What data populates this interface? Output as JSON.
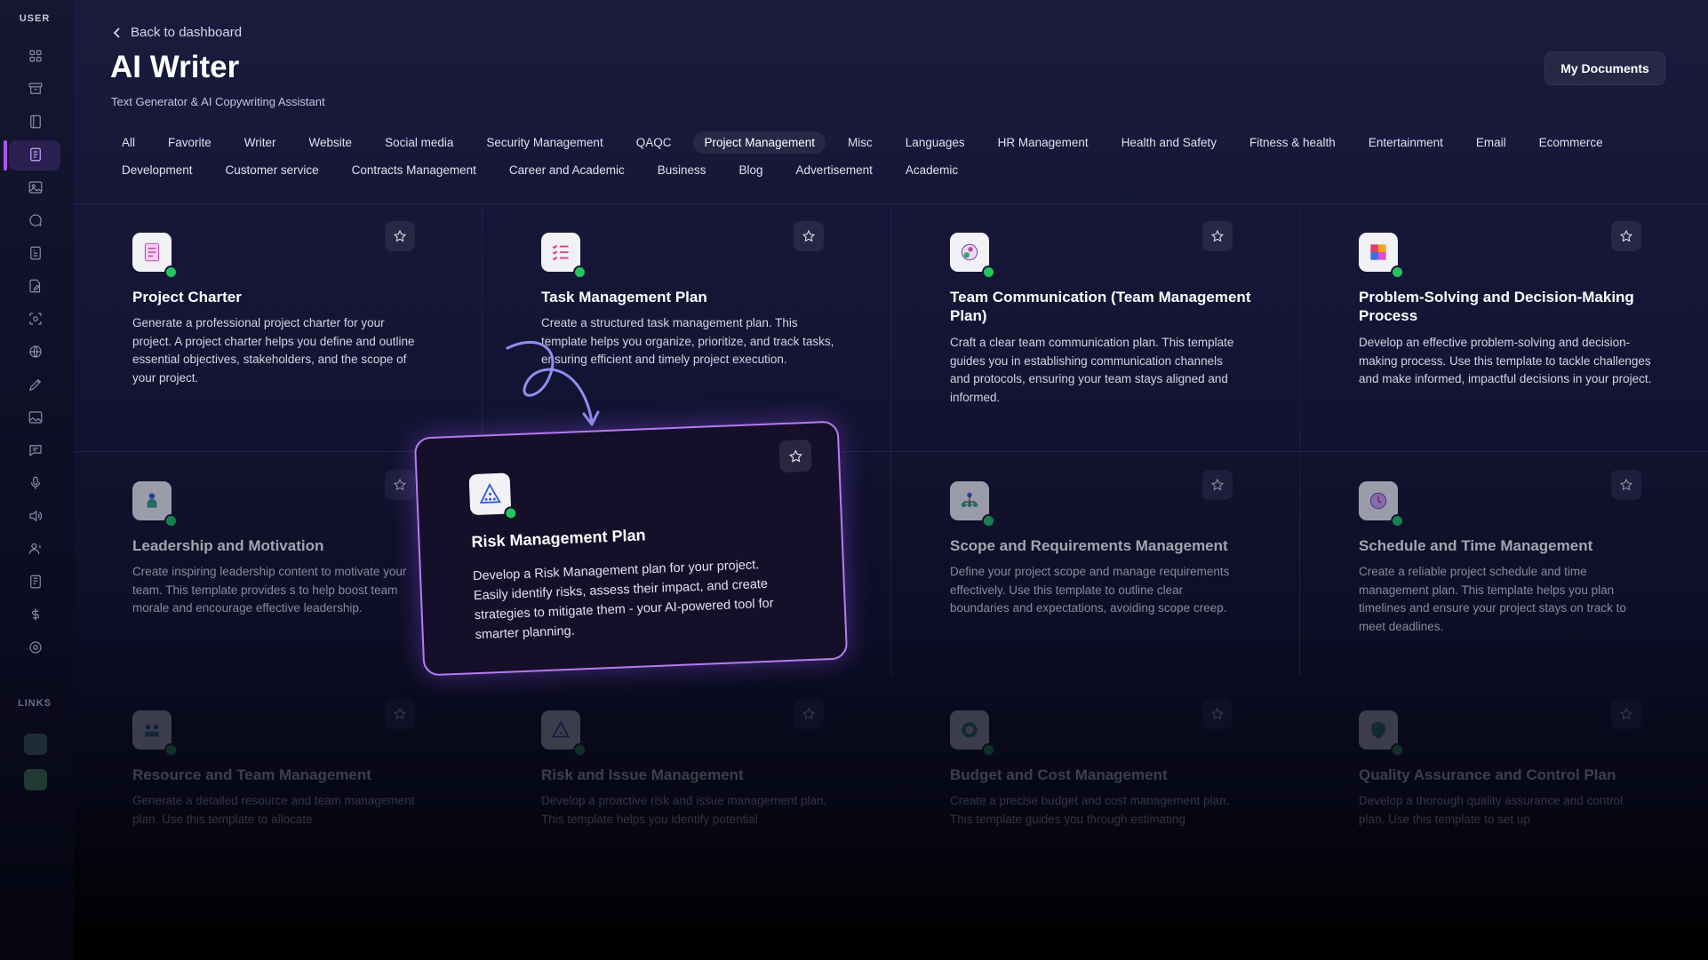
{
  "sidebar": {
    "user_label": "USER",
    "links_label": "LINKS",
    "icons": [
      "grid-icon",
      "archive-icon",
      "book-icon",
      "document-icon",
      "image-icon",
      "chat-bubble-icon",
      "file-text-icon",
      "file-edit-icon",
      "scan-icon",
      "globe-icon",
      "pen-icon",
      "photo-icon",
      "message-icon",
      "microphone-icon",
      "speaker-icon",
      "user-voice-icon",
      "notebook-icon",
      "dollar-icon",
      "settings-icon"
    ],
    "active_index": 3,
    "accent_color": "#a855f7"
  },
  "header": {
    "back_label": "Back to dashboard",
    "title": "AI Writer",
    "subtitle": "Text Generator & AI Copywriting Assistant",
    "my_documents_label": "My Documents"
  },
  "filters": {
    "row1": [
      "All",
      "Favorite",
      "Writer",
      "Website",
      "Social media",
      "Security Management",
      "QAQC",
      "Project Management",
      "Misc",
      "Languages",
      "HR Management",
      "Health and Safety",
      "Fitness & health",
      "Entertainment",
      "Email",
      "Ecommerce"
    ],
    "row2": [
      "Development",
      "Customer service",
      "Contracts Management",
      "Career and Academic",
      "Business",
      "Blog",
      "Advertisement",
      "Academic"
    ],
    "active": "Project Management"
  },
  "cards": [
    {
      "title": "Project Charter",
      "description": "Generate a professional project charter for your project. A project charter helps you define and outline essential objectives, stakeholders, and the scope of your project.",
      "icon": "charter-icon"
    },
    {
      "title": "Task Management Plan",
      "description": "Create a structured task management plan. This template helps you organize, prioritize, and track tasks, ensuring efficient and timely project execution.",
      "icon": "checklist-icon"
    },
    {
      "title": "Team Communication (Team Management Plan)",
      "description": "Craft a clear team communication plan. This template guides you in establishing communication channels and protocols, ensuring your team stays aligned and informed.",
      "icon": "team-chat-icon"
    },
    {
      "title": "Problem-Solving and Decision-Making Process",
      "description": "Develop an effective problem-solving and decision-making process. Use this template to tackle challenges and make informed, impactful decisions in your project.",
      "icon": "puzzle-icon"
    },
    {
      "title": "Leadership and Motivation",
      "description": "Create inspiring leadership content to motivate your team. This template provides s to help boost team morale and encourage effective leadership.",
      "icon": "leader-icon"
    },
    {
      "title": "Scope and Requirements Management",
      "description": "Define your project scope and manage requirements effectively. Use this template to outline clear boundaries and expectations, avoiding scope creep.",
      "icon": "hierarchy-icon"
    },
    {
      "title": "Schedule and Time Management",
      "description": "Create a reliable project schedule and time management plan. This template helps you plan timelines and ensure your project stays on track to meet deadlines.",
      "icon": "clock-icon"
    },
    {
      "title": "Resource and Team Management",
      "description": "Generate a detailed resource and team management plan. Use this template to allocate",
      "icon": "resource-icon"
    },
    {
      "title": "Risk and Issue Management",
      "description": "Develop a proactive risk and issue management plan. This template helps you identify potential",
      "icon": "warning-icon"
    },
    {
      "title": "Budget and Cost Management",
      "description": "Create a precise budget and cost management plan. This template guides you through estimating",
      "icon": "budget-icon"
    },
    {
      "title": "Quality Assurance and Control Plan",
      "description": "Develop a thorough quality assurance and control plan. Use this template to set up",
      "icon": "shield-icon"
    }
  ],
  "highlight": {
    "title": "Risk Management Plan",
    "description": "Develop a Risk Management plan for your project. Easily identify risks, assess their impact, and create strategies to mitigate them - your AI-powered tool for smarter planning.",
    "icon": "risk-triangle-icon",
    "border_color": "#b57cf2"
  }
}
